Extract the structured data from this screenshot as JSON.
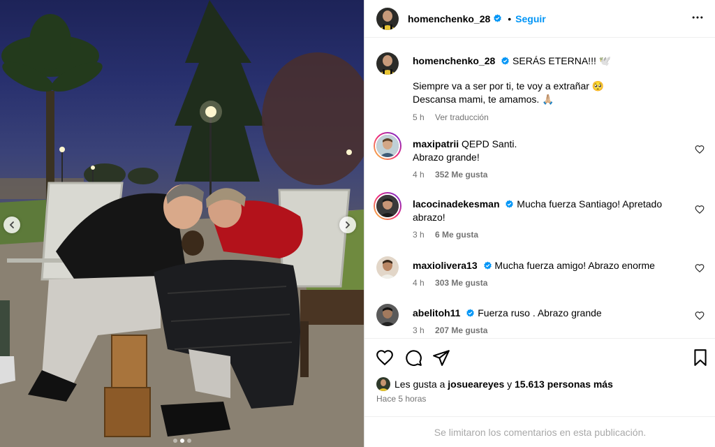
{
  "post": {
    "author": "homenchenko_28",
    "follow_label": "Seguir",
    "separator": "•",
    "caption_title": "SERÁS ETERNA!!! 🕊️",
    "caption_line1": "Siempre va a ser por ti, te voy a extrañar 🥺",
    "caption_line2": "Descansa mami, te amamos. 🙏🏼",
    "caption_time": "5 h",
    "translate_label": "Ver traducción"
  },
  "comments": [
    {
      "user": "maxipatrii",
      "verified": false,
      "story_ring": true,
      "text": "QEPD Santi.",
      "text2": "Abrazo grande!",
      "time": "4 h",
      "likes": "352 Me gusta"
    },
    {
      "user": "lacocinadekesman",
      "verified": true,
      "story_ring": true,
      "text": "Mucha fuerza Santiago! Apretado",
      "text2": "abrazo!",
      "time": "3 h",
      "likes": "6 Me gusta"
    },
    {
      "user": "maxiolivera13",
      "verified": true,
      "story_ring": false,
      "text": "Mucha fuerza amigo! Abrazo enorme",
      "text2": "",
      "time": "4 h",
      "likes": "303 Me gusta"
    },
    {
      "user": "abelitoh11",
      "verified": true,
      "story_ring": false,
      "text": "Fuerza ruso . Abrazo grande",
      "text2": "",
      "time": "3 h",
      "likes": "207 Me gusta"
    }
  ],
  "likes": {
    "prefix": "Les gusta a",
    "user": "josueareyes",
    "conj": "y",
    "count": "15.613 personas más"
  },
  "posted_ago": "Hace 5 horas",
  "comments_limited": "Se limitaron los comentarios en esta publicación.",
  "carousel": {
    "total": 3,
    "active": 2
  },
  "icons": [
    "verified-icon",
    "more-icon",
    "heart-icon",
    "comment-icon",
    "share-icon",
    "bookmark-icon",
    "chevron-left-icon",
    "chevron-right-icon"
  ],
  "colors": {
    "accent": "#0095f6",
    "verified": "#0095f6",
    "muted": "#737373",
    "border": "#dbdbdb"
  }
}
